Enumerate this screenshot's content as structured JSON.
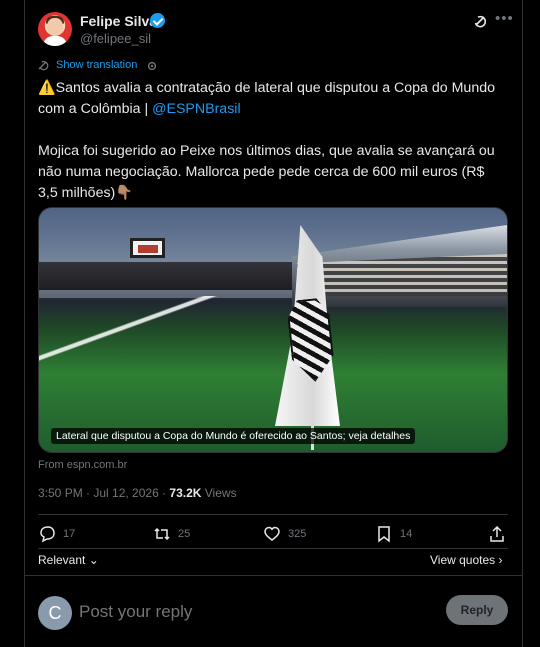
{
  "author": {
    "name": "Felipe Silva",
    "handle": "@felipee_sil"
  },
  "translation": {
    "label": "Show translation"
  },
  "tweet": {
    "lines": [
      "⚠️Santos avalia a contratação de lateral que disputou a Copa do Mundo",
      "com a Colômbia | "
    ],
    "mention": "@ESPNBrasil",
    "paragraph": [
      "Mojica foi sugerido ao Peixe nos últimos dias, que avalia se avançará ou",
      "não numa negociação. Mallorca pede pede cerca de 600 mil euros (R$",
      "3,5 milhões)👇🏽"
    ]
  },
  "media": {
    "caption": "Lateral que disputou a Copa do Mundo é oferecido ao Santos; veja detalhes",
    "source": "From espn.com.br"
  },
  "meta": {
    "time_date": "3:50 PM · Jul 12, 2026 · ",
    "views_count": "73.2K",
    "views_label": " Views"
  },
  "actions": {
    "replies": "17",
    "reposts": "25",
    "likes": "325",
    "bookmarks": "14"
  },
  "filters": {
    "relevant": "Relevant",
    "view_quotes": "View quotes"
  },
  "reply": {
    "avatar_initial": "C",
    "placeholder": "Post your reply",
    "button": "Reply"
  },
  "icons": [
    "verified-badge-icon",
    "grok-icon",
    "more-icon",
    "translate-icon",
    "gear-icon",
    "reply-icon",
    "repost-icon",
    "like-icon",
    "bookmark-icon",
    "share-icon",
    "chevron-down-icon",
    "chevron-right-icon"
  ],
  "colors": {
    "background": "#000000",
    "text": "#e7e9ea",
    "muted": "#71767b",
    "accent": "#1d9bf0",
    "border": "#2f3336"
  }
}
